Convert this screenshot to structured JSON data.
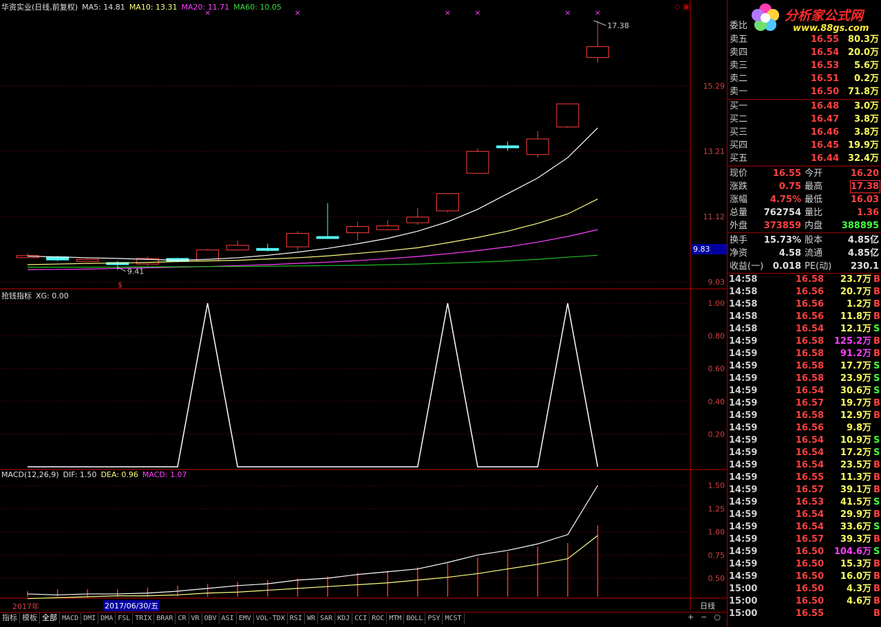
{
  "main_title": {
    "name": "华资实业(日线,前复权)",
    "ma5": "MA5: 14.81",
    "ma10": "MA10: 13.31",
    "ma20": "MA20: 11.71",
    "ma60": "MA60: 10.05"
  },
  "colors": {
    "up": "#ff3c3c",
    "down": "#54fcfc",
    "ma5": "#ffffff",
    "ma10": "#ffff80",
    "ma20": "#ff40ff",
    "ma60": "#20c020",
    "grid": "#7a1010",
    "axis": "#c00000"
  },
  "chart_data": [
    {
      "type": "candlestick",
      "title": "华资实业(日线,前复权)",
      "ylim": [
        9.03,
        17.6
      ],
      "y_ticks": [
        "15.29",
        "13.21",
        "11.12",
        "9.03"
      ],
      "high_label": "17.38",
      "low_label": "9.41",
      "current_price_label": "9.83",
      "candles": [
        {
          "o": 9.87,
          "c": 9.87,
          "h": 9.95,
          "l": 9.8
        },
        {
          "o": 9.83,
          "c": 9.73,
          "h": 9.86,
          "l": 9.7
        },
        {
          "o": 9.72,
          "c": 9.75,
          "h": 9.78,
          "l": 9.68
        },
        {
          "o": 9.65,
          "c": 9.58,
          "h": 9.7,
          "l": 9.41
        },
        {
          "o": 9.6,
          "c": 9.78,
          "h": 9.84,
          "l": 9.55
        },
        {
          "o": 9.78,
          "c": 9.68,
          "h": 9.8,
          "l": 9.65
        },
        {
          "o": 9.7,
          "c": 10.05,
          "h": 10.08,
          "l": 9.68
        },
        {
          "o": 10.05,
          "c": 10.2,
          "h": 10.35,
          "l": 10.02
        },
        {
          "o": 10.1,
          "c": 10.06,
          "h": 10.25,
          "l": 10.0
        },
        {
          "o": 10.15,
          "c": 10.58,
          "h": 10.65,
          "l": 10.05
        },
        {
          "o": 10.48,
          "c": 10.45,
          "h": 11.55,
          "l": 10.4
        },
        {
          "o": 10.6,
          "c": 10.8,
          "h": 10.95,
          "l": 10.35
        },
        {
          "o": 10.7,
          "c": 10.82,
          "h": 11.0,
          "l": 10.68
        },
        {
          "o": 10.92,
          "c": 11.1,
          "h": 11.4,
          "l": 10.85
        },
        {
          "o": 11.3,
          "c": 11.85,
          "h": 11.85,
          "l": 11.25
        },
        {
          "o": 12.5,
          "c": 13.2,
          "h": 13.3,
          "l": 12.5
        },
        {
          "o": 13.38,
          "c": 13.35,
          "h": 13.52,
          "l": 13.22
        },
        {
          "o": 13.1,
          "c": 13.6,
          "h": 13.85,
          "l": 13.0
        },
        {
          "o": 13.98,
          "c": 14.72,
          "h": 14.72,
          "l": 13.95
        },
        {
          "o": 16.2,
          "c": 16.55,
          "h": 17.38,
          "l": 16.03
        }
      ],
      "ma5": [
        9.85,
        9.83,
        9.8,
        9.78,
        9.75,
        9.72,
        9.75,
        9.8,
        9.88,
        9.98,
        10.1,
        10.25,
        10.42,
        10.65,
        10.95,
        11.35,
        11.85,
        12.35,
        13.0,
        13.95
      ],
      "ma10": [
        9.58,
        9.6,
        9.62,
        9.63,
        9.65,
        9.68,
        9.7,
        9.72,
        9.76,
        9.8,
        9.86,
        9.94,
        10.02,
        10.12,
        10.28,
        10.45,
        10.65,
        10.9,
        11.2,
        11.68
      ],
      "ma20": [
        9.42,
        9.43,
        9.44,
        9.46,
        9.48,
        9.5,
        9.52,
        9.55,
        9.58,
        9.62,
        9.66,
        9.71,
        9.77,
        9.84,
        9.93,
        10.03,
        10.15,
        10.3,
        10.48,
        10.7
      ],
      "ma60": [
        9.5,
        9.5,
        9.5,
        9.5,
        9.51,
        9.51,
        9.52,
        9.52,
        9.53,
        9.54,
        9.55,
        9.56,
        9.58,
        9.6,
        9.63,
        9.66,
        9.7,
        9.75,
        9.82,
        9.88
      ]
    },
    {
      "type": "line",
      "title": "抢钱指标",
      "xg": "XG: 0.00",
      "ylim": [
        0,
        1.0
      ],
      "y_ticks": [
        "1.00",
        "0.80",
        "0.60",
        "0.40",
        "0.20"
      ],
      "values": [
        0,
        0,
        0,
        0,
        0,
        0,
        1,
        0,
        0,
        0,
        0,
        0,
        0,
        0,
        1,
        0,
        0,
        0,
        1,
        0
      ]
    },
    {
      "type": "line",
      "title": "MACD(12,26,9)",
      "dif_label": "DIF: 1.50",
      "dea_label": "DEA: 0.96",
      "macd_label": "MACD: 1.07",
      "ylim": [
        0.3,
        1.62
      ],
      "y_ticks": [
        "1.50",
        "1.25",
        "1.00",
        "0.75",
        "0.50"
      ],
      "dif": [
        0.33,
        0.32,
        0.33,
        0.33,
        0.34,
        0.36,
        0.39,
        0.42,
        0.44,
        0.48,
        0.5,
        0.54,
        0.57,
        0.6,
        0.67,
        0.75,
        0.8,
        0.87,
        0.97,
        1.5
      ],
      "dea": [
        0.28,
        0.29,
        0.3,
        0.31,
        0.31,
        0.32,
        0.34,
        0.35,
        0.37,
        0.39,
        0.41,
        0.43,
        0.45,
        0.48,
        0.51,
        0.55,
        0.6,
        0.65,
        0.71,
        0.96
      ],
      "macd": [
        0.36,
        0.38,
        0.38,
        0.38,
        0.4,
        0.42,
        0.44,
        0.46,
        0.48,
        0.5,
        0.52,
        0.56,
        0.58,
        0.62,
        0.66,
        0.72,
        0.78,
        0.84,
        0.88,
        1.07
      ]
    }
  ],
  "date_labels": {
    "year": "2017年",
    "cursor_date": "2017/06/30/五",
    "period": "日线"
  },
  "tabs": [
    "指标",
    "模板",
    "全部",
    "MACD",
    "DMI",
    "DMA",
    "FSL",
    "TRIX",
    "BRAR",
    "CR",
    "VR",
    "OBV",
    "ASI",
    "EMV",
    "VOL-TDX",
    "RSI",
    "WR",
    "SAR",
    "KDJ",
    "CCI",
    "ROC",
    "MTM",
    "BOLL",
    "PSY",
    "MCST"
  ],
  "tab_controls": [
    "+",
    "−",
    "○"
  ],
  "order_book": {
    "header": "委比",
    "sells": [
      {
        "label": "卖五",
        "price": "16.55",
        "vol": "80.3万"
      },
      {
        "label": "卖四",
        "price": "16.54",
        "vol": "20.0万"
      },
      {
        "label": "卖三",
        "price": "16.53",
        "vol": "5.6万"
      },
      {
        "label": "卖二",
        "price": "16.51",
        "vol": "0.2万"
      },
      {
        "label": "卖一",
        "price": "16.50",
        "vol": "71.8万"
      }
    ],
    "buys": [
      {
        "label": "买一",
        "price": "16.48",
        "vol": "3.0万"
      },
      {
        "label": "买二",
        "price": "16.47",
        "vol": "3.8万"
      },
      {
        "label": "买三",
        "price": "16.46",
        "vol": "3.8万"
      },
      {
        "label": "买四",
        "price": "16.45",
        "vol": "19.9万"
      },
      {
        "label": "买五",
        "price": "16.44",
        "vol": "32.4万"
      }
    ]
  },
  "stats": [
    {
      "l1": "现价",
      "v1": "16.55",
      "c1": "red",
      "l2": "今开",
      "v2": "16.20",
      "c2": "red"
    },
    {
      "l1": "涨跌",
      "v1": "0.75",
      "c1": "red",
      "l2": "最高",
      "v2": "17.38",
      "c2": "red"
    },
    {
      "l1": "涨幅",
      "v1": "4.75%",
      "c1": "red",
      "l2": "最低",
      "v2": "16.03",
      "c2": "red"
    },
    {
      "l1": "总量",
      "v1": "762754",
      "c1": "white",
      "l2": "量比",
      "v2": "1.36",
      "c2": "red"
    },
    {
      "l1": "外盘",
      "v1": "373859",
      "c1": "red",
      "l2": "内盘",
      "v2": "388895",
      "c2": "green"
    }
  ],
  "stats2": [
    {
      "l1": "换手",
      "v1": "15.73%",
      "l2": "股本",
      "v2": "4.85亿"
    },
    {
      "l1": "净资",
      "v1": "4.58",
      "l2": "流通",
      "v2": "4.85亿"
    },
    {
      "l1": "收益(一)",
      "v1": "0.018",
      "l2": "PE(动)",
      "v2": "230.1"
    }
  ],
  "ticks": [
    {
      "t": "14:58",
      "p": "16.58",
      "v": "23.7万",
      "s": "B"
    },
    {
      "t": "14:58",
      "p": "16.56",
      "v": "20.7万",
      "s": "B"
    },
    {
      "t": "14:58",
      "p": "16.56",
      "v": "1.2万",
      "s": "B"
    },
    {
      "t": "14:58",
      "p": "16.56",
      "v": "11.8万",
      "s": "B"
    },
    {
      "t": "14:58",
      "p": "16.54",
      "v": "12.1万",
      "s": "S"
    },
    {
      "t": "14:59",
      "p": "16.58",
      "v": "125.2万",
      "s": "B"
    },
    {
      "t": "14:59",
      "p": "16.58",
      "v": "91.2万",
      "s": "B"
    },
    {
      "t": "14:59",
      "p": "16.58",
      "v": "17.7万",
      "s": "S"
    },
    {
      "t": "14:59",
      "p": "16.58",
      "v": "23.9万",
      "s": "S"
    },
    {
      "t": "14:59",
      "p": "16.54",
      "v": "30.6万",
      "s": "S"
    },
    {
      "t": "14:59",
      "p": "16.57",
      "v": "19.7万",
      "s": "B"
    },
    {
      "t": "14:59",
      "p": "16.58",
      "v": "12.9万",
      "s": "B"
    },
    {
      "t": "14:59",
      "p": "16.56",
      "v": "9.8万",
      "s": ""
    },
    {
      "t": "14:59",
      "p": "16.54",
      "v": "10.9万",
      "s": "S"
    },
    {
      "t": "14:59",
      "p": "16.54",
      "v": "17.2万",
      "s": "S"
    },
    {
      "t": "14:59",
      "p": "16.54",
      "v": "23.5万",
      "s": "B"
    },
    {
      "t": "14:59",
      "p": "16.55",
      "v": "11.3万",
      "s": "B"
    },
    {
      "t": "14:59",
      "p": "16.57",
      "v": "39.1万",
      "s": "B"
    },
    {
      "t": "14:59",
      "p": "16.53",
      "v": "41.5万",
      "s": "S"
    },
    {
      "t": "14:59",
      "p": "16.54",
      "v": "29.9万",
      "s": "B"
    },
    {
      "t": "14:59",
      "p": "16.54",
      "v": "33.6万",
      "s": "S"
    },
    {
      "t": "14:59",
      "p": "16.57",
      "v": "39.3万",
      "s": "B"
    },
    {
      "t": "14:59",
      "p": "16.50",
      "v": "104.6万",
      "s": "S"
    },
    {
      "t": "14:59",
      "p": "16.50",
      "v": "15.3万",
      "s": "B"
    },
    {
      "t": "14:59",
      "p": "16.50",
      "v": "16.0万",
      "s": "B"
    },
    {
      "t": "15:00",
      "p": "16.50",
      "v": "4.3万",
      "s": "B"
    },
    {
      "t": "15:00",
      "p": "16.50",
      "v": "4.6万",
      "s": "B"
    },
    {
      "t": "15:00",
      "p": "16.55",
      "v": "",
      "s": "B"
    }
  ],
  "logo": {
    "title": "分析家公式网",
    "url": "www.88gs.com"
  }
}
